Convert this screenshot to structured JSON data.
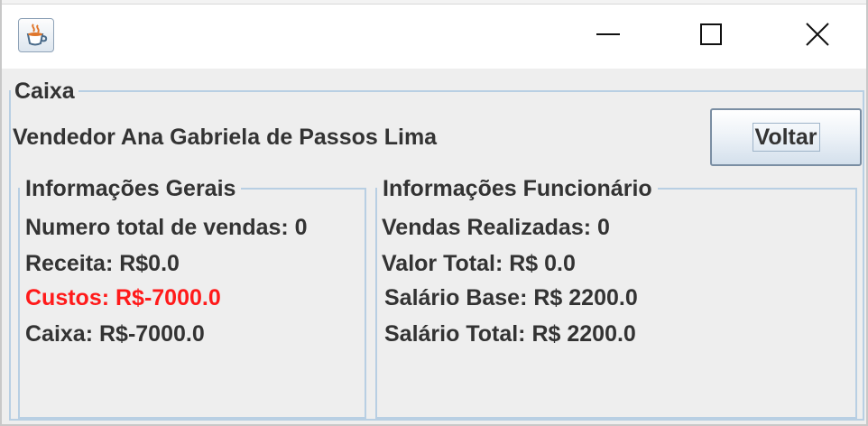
{
  "window": {
    "icon": "java-cup-icon",
    "controls": {
      "minimize": "minimize-icon",
      "maximize": "maximize-icon",
      "close": "close-icon"
    }
  },
  "caixa": {
    "legend": "Caixa",
    "vendedor_text": "Vendedor Ana Gabriela de Passos Lima",
    "voltar_label": "Voltar"
  },
  "gerais": {
    "legend": "Informações Gerais",
    "lines": [
      "Numero total de vendas: 0",
      "Receita: R$0.0",
      "Custos: R$-7000.0",
      "Caixa: R$-7000.0"
    ],
    "custos_color": "#ff1a1a"
  },
  "funcionario": {
    "legend": "Informações Funcionário",
    "lines": [
      "Vendas Realizadas: 0",
      "Valor Total: R$ 0.0",
      "Salário Base: R$ 2200.0",
      "Salário Total: R$ 2200.0"
    ]
  }
}
